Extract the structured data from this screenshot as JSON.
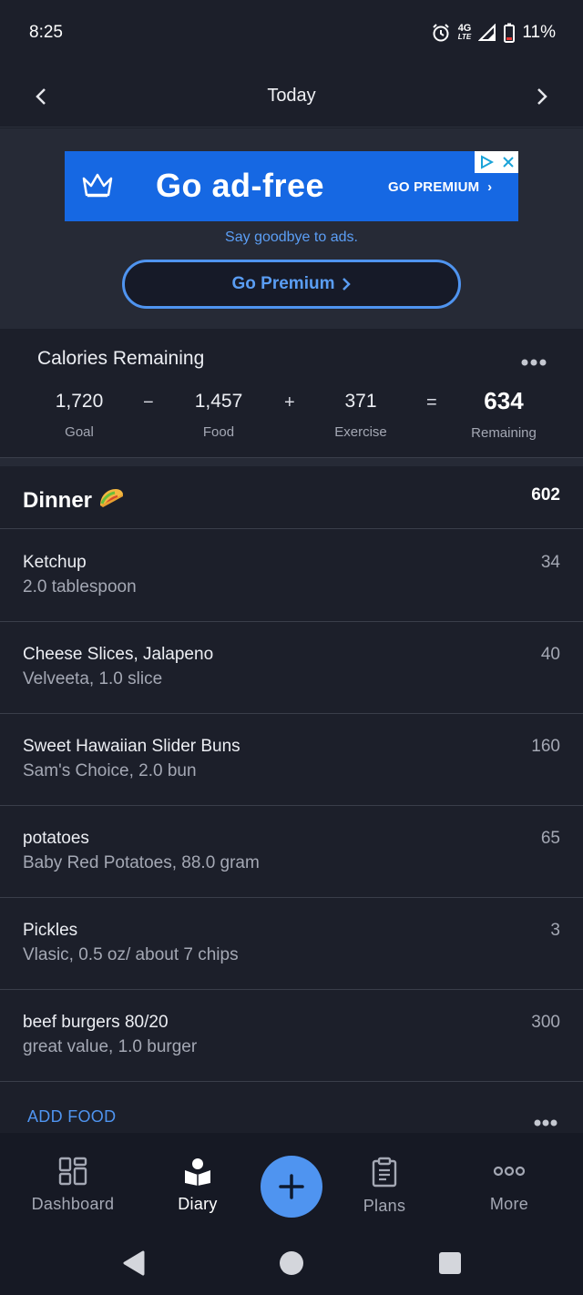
{
  "status_bar": {
    "time": "8:25",
    "network": "4G",
    "network_sub": "LTE",
    "battery": "11%"
  },
  "header": {
    "title": "Today"
  },
  "ad": {
    "headline": "Go ad-free",
    "cta": "GO PREMIUM",
    "subtext": "Say goodbye to ads.",
    "button_label": "Go Premium",
    "accent": "#1668e3"
  },
  "calories": {
    "title": "Calories Remaining",
    "goal": {
      "value": "1,720",
      "label": "Goal"
    },
    "food": {
      "value": "1,457",
      "label": "Food"
    },
    "exercise": {
      "value": "371",
      "label": "Exercise"
    },
    "remaining": {
      "value": "634",
      "label": "Remaining"
    },
    "ops": {
      "minus": "−",
      "plus": "+",
      "equals": "="
    }
  },
  "meal": {
    "title": "Dinner",
    "emoji": "🌮",
    "total": "602",
    "items": [
      {
        "name": "Ketchup",
        "desc": "2.0 tablespoon",
        "cal": "34"
      },
      {
        "name": "Cheese Slices, Jalapeno",
        "desc": "Velveeta, 1.0 slice",
        "cal": "40"
      },
      {
        "name": "Sweet Hawaiian Slider Buns",
        "desc": "Sam's Choice, 2.0 bun",
        "cal": "160"
      },
      {
        "name": "potatoes",
        "desc": "Baby Red Potatoes, 88.0 gram",
        "cal": "65"
      },
      {
        "name": "Pickles",
        "desc": "Vlasic, 0.5 oz/ about 7 chips",
        "cal": "3"
      },
      {
        "name": "beef burgers 80/20",
        "desc": "great value, 1.0 burger",
        "cal": "300"
      }
    ],
    "add_label": "ADD FOOD"
  },
  "tabs": [
    {
      "label": "Dashboard",
      "icon": "dashboard-icon"
    },
    {
      "label": "Diary",
      "icon": "diary-icon",
      "active": true
    },
    {
      "label": "Plans",
      "icon": "clipboard-icon"
    },
    {
      "label": "More",
      "icon": "more-dots-icon"
    }
  ],
  "colors": {
    "background": "#1c1f2a",
    "accent": "#4f94f0",
    "muted": "#a4a8b4"
  }
}
